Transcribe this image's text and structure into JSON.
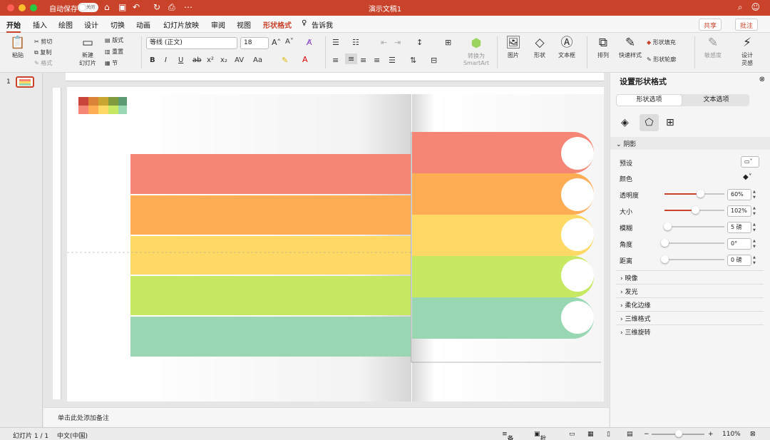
{
  "window": {
    "title": "演示文稿1",
    "autosave_label": "自动保存",
    "autosave_state": "关闭"
  },
  "tabs": [
    "开始",
    "插入",
    "绘图",
    "设计",
    "切换",
    "动画",
    "幻灯片放映",
    "审阅",
    "视图",
    "形状格式",
    "告诉我"
  ],
  "header_buttons": {
    "share": "共享",
    "comment": "批注"
  },
  "ribbon": {
    "paste": "粘贴",
    "cut": "剪切",
    "copy": "复制",
    "format": "格式",
    "new_slide": "新建\n幻灯片",
    "layout": "版式",
    "reset": "重置",
    "section": "节",
    "font": "等线 (正文)",
    "size": "18",
    "convert_smartart": "转换为\nSmartArt",
    "picture": "图片",
    "shape": "形状",
    "textbox": "文本框",
    "arrange": "排列",
    "quick_styles": "快速样式",
    "shape_fill": "形状填充",
    "shape_outline": "形状轮廓",
    "sensitivity": "敏感度",
    "design_ideas": "设计\n灵感"
  },
  "thumbnail_number": "1",
  "notes_placeholder": "单击此处添加备注",
  "panel": {
    "title": "设置形状格式",
    "shape_options": "形状选项",
    "text_options": "文本选项",
    "shadow": "阴影",
    "preset": "预设",
    "color": "颜色",
    "transparency": {
      "label": "透明度",
      "value": "60%",
      "fraction": 0.6
    },
    "size": {
      "label": "大小",
      "value": "102%",
      "fraction": 0.51
    },
    "blur": {
      "label": "模糊",
      "value": "5 磅",
      "fraction": 0.05
    },
    "angle": {
      "label": "角度",
      "value": "0°",
      "fraction": 0
    },
    "distance": {
      "label": "距离",
      "value": "0 磅",
      "fraction": 0
    },
    "sections": [
      "映像",
      "发光",
      "柔化边缘",
      "三维格式",
      "三维旋转"
    ]
  },
  "status": {
    "slide": "幻灯片 1 / 1",
    "language": "中文(中国)",
    "notes": "备注",
    "comments": "批注",
    "zoom": "110%"
  },
  "colors": {
    "accent": "#c9432b",
    "red": "#f58575",
    "orange": "#ffad55",
    "yellow": "#ffd966",
    "green": "#c6e862",
    "teal": "#98d7b2"
  }
}
